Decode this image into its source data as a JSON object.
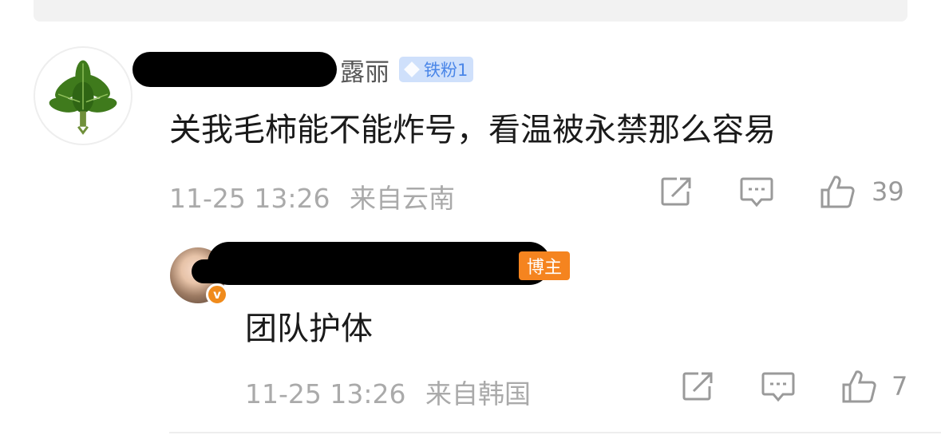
{
  "comment": {
    "username_visible": "露丽",
    "fan_badge": "铁粉1",
    "text": "关我毛柿能不能炸号，看温被永禁那么容易",
    "time": "11-25 13:26",
    "location": "来自云南",
    "likes": "39"
  },
  "reply": {
    "author_badge": "博主",
    "text": "团队护体",
    "time": "11-25 13:26",
    "location": "来自韩国",
    "likes": "7"
  },
  "icons": {
    "share": "share-icon",
    "comment": "comment-icon",
    "like": "thumbs-up-icon",
    "verify": "verified-v-icon",
    "fan": "diamond-icon"
  },
  "colors": {
    "accent_orange": "#f5841f",
    "fan_badge_bg": "#cfe0fb",
    "fan_badge_text": "#4a86e8",
    "meta_gray": "#aaaaaa"
  }
}
